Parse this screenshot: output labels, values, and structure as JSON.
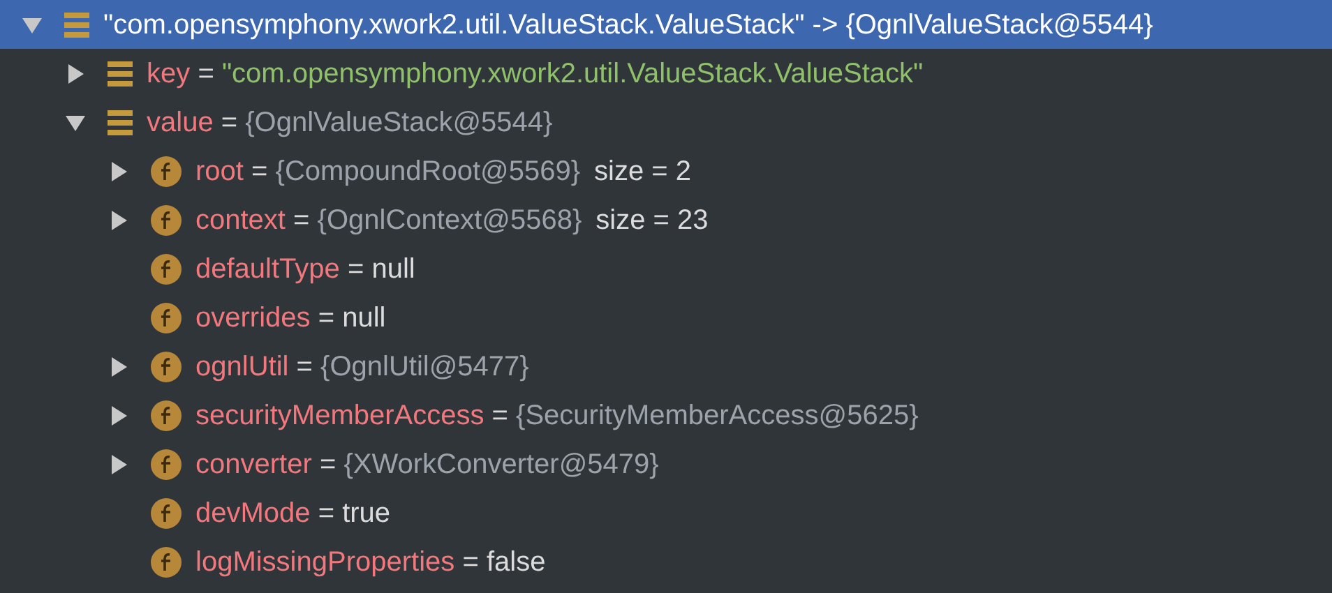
{
  "tree": [
    {
      "kind": "entry",
      "name": "\"com.opensymphony.xwork2.util.ValueStack.ValueStack\"",
      "separator": "->",
      "value": {
        "kind": "object",
        "text": "{OgnlValueStack@5544}"
      },
      "selected": true,
      "expanded": true,
      "children": [
        {
          "kind": "entry",
          "name": "key",
          "separator": "=",
          "value": {
            "kind": "string",
            "text": "\"com.opensymphony.xwork2.util.ValueStack.ValueStack\""
          },
          "selected": false,
          "expanded": false
        },
        {
          "kind": "entry",
          "name": "value",
          "separator": "=",
          "value": {
            "kind": "object",
            "text": "{OgnlValueStack@5544}"
          },
          "selected": false,
          "expanded": true,
          "children": [
            {
              "kind": "field",
              "name": "root",
              "separator": "=",
              "value": {
                "kind": "object",
                "text": "{CompoundRoot@5569}"
              },
              "extra": "size = 2",
              "selected": false,
              "expanded": false
            },
            {
              "kind": "field",
              "name": "context",
              "separator": "=",
              "value": {
                "kind": "object",
                "text": "{OgnlContext@5568}"
              },
              "extra": "size = 23",
              "selected": false,
              "expanded": false
            },
            {
              "kind": "field",
              "name": "defaultType",
              "separator": "=",
              "value": {
                "kind": "literal",
                "text": "null"
              },
              "selected": false
            },
            {
              "kind": "field",
              "name": "overrides",
              "separator": "=",
              "value": {
                "kind": "literal",
                "text": "null"
              },
              "selected": false
            },
            {
              "kind": "field",
              "name": "ognlUtil",
              "separator": "=",
              "value": {
                "kind": "object",
                "text": "{OgnlUtil@5477}"
              },
              "selected": false,
              "expanded": false
            },
            {
              "kind": "field",
              "name": "securityMemberAccess",
              "separator": "=",
              "value": {
                "kind": "object",
                "text": "{SecurityMemberAccess@5625}"
              },
              "selected": false,
              "expanded": false
            },
            {
              "kind": "field",
              "name": "converter",
              "separator": "=",
              "value": {
                "kind": "object",
                "text": "{XWorkConverter@5479}"
              },
              "selected": false,
              "expanded": false
            },
            {
              "kind": "field",
              "name": "devMode",
              "separator": "=",
              "value": {
                "kind": "literal",
                "text": "true"
              },
              "selected": false
            },
            {
              "kind": "field",
              "name": "logMissingProperties",
              "separator": "=",
              "value": {
                "kind": "literal",
                "text": "false"
              },
              "selected": false
            }
          ]
        }
      ]
    }
  ]
}
